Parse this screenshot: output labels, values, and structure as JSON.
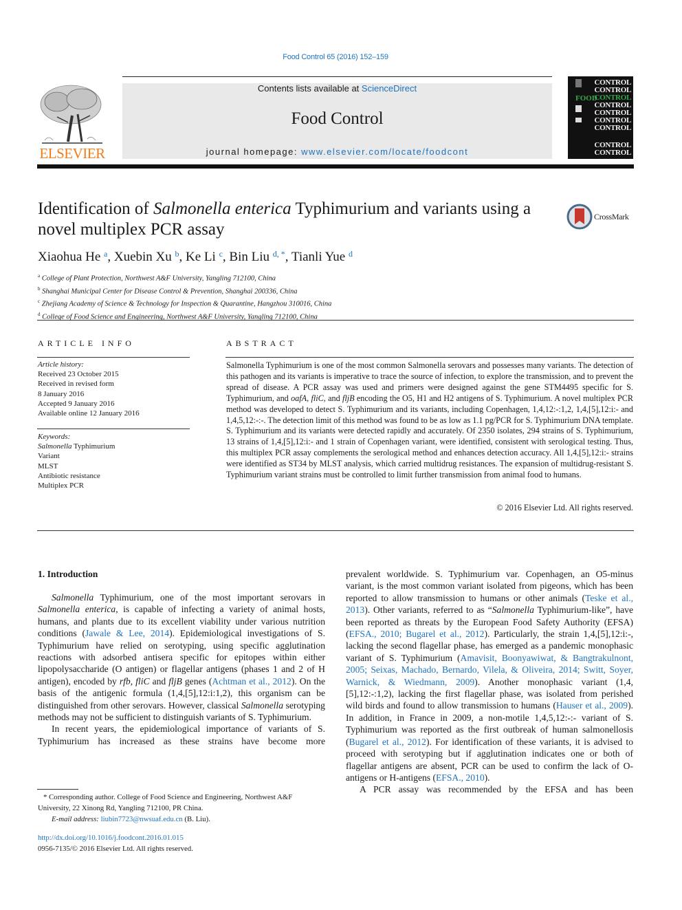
{
  "header": {
    "citation": "Food Control 65 (2016) 152–159",
    "publisher_name": "ELSEVIER",
    "contents_prefix": "Contents lists available at ",
    "contents_link": "ScienceDirect",
    "journal_title": "Food Control",
    "homepage_prefix": "journal homepage: ",
    "homepage_link": "www.elsevier.com/locate/foodcont",
    "cover": {
      "word": "CONTROL",
      "food_word": "FOOD",
      "colors": {
        "background": "#111111",
        "food": "#37a84a",
        "text": "#f2f2f2"
      }
    },
    "colors": {
      "link": "#1e73be",
      "publisher": "#f07c1c",
      "box": "#e9e9e9"
    }
  },
  "article": {
    "title_part1": "Identification of ",
    "title_italic": "Salmonella enterica",
    "title_part2": " Typhimurium and variants using a novel multiplex PCR assay",
    "crossmark_label": "CrossMark",
    "authors": [
      {
        "name": "Xiaohua He",
        "sup": "a"
      },
      {
        "name": "Xuebin Xu",
        "sup": "b"
      },
      {
        "name": "Ke Li",
        "sup": "c"
      },
      {
        "name": "Bin Liu",
        "sup": "d, *"
      },
      {
        "name": "Tianli Yue",
        "sup": "d"
      }
    ],
    "affiliations": [
      {
        "key": "a",
        "text": "College of Plant Protection, Northwest A&F University, Yangling 712100, China"
      },
      {
        "key": "b",
        "text": "Shanghai Municipal Center for Disease Control & Prevention, Shanghai 200336, China"
      },
      {
        "key": "c",
        "text": "Zhejiang Academy of Science & Technology for Inspection & Quarantine, Hangzhou 310016, China"
      },
      {
        "key": "d",
        "text": "College of Food Science and Engineering, Northwest A&F University, Yangling 712100, China"
      }
    ]
  },
  "article_info": {
    "heading": "ARTICLE INFO",
    "history_label": "Article history:",
    "history": [
      "Received 23 October 2015",
      "Received in revised form",
      "8 January 2016",
      "Accepted 9 January 2016",
      "Available online 12 January 2016"
    ],
    "keywords_label": "Keywords:",
    "keyword1_italic": "Salmonella",
    "keyword1_rest": " Typhimurium",
    "keywords": [
      "Variant",
      "MLST",
      "Antibiotic resistance",
      "Multiplex PCR"
    ]
  },
  "abstract": {
    "heading": "ABSTRACT",
    "s1": "Salmonella Typhimurium is one of the most common Salmonella serovars and possesses many variants. The detection of this pathogen and its variants is imperative to trace the source of infection, to explore the transmission, and to prevent the spread of disease. A PCR assay was used and primers were designed against the gene STM4495 specific for S. Typhimurium, and ",
    "g1": "oafA",
    "c1": ", ",
    "g2": "fliC",
    "c2": ", and ",
    "g3": "fljB",
    "s2": " encoding the O5, H1 and H2 antigens of S. Typhimurium. A novel multiplex PCR method was developed to detect S. Typhimurium and its variants, including Copenhagen, 1,4,12:-:1,2, 1,4,[5],12:i:- and 1,4,5,12:-:-. The detection limit of this method was found to be as low as 1.1 pg/PCR for S. Typhimurium DNA template. S. Typhimurium and its variants were detected rapidly and accurately. Of 2350 isolates, 294 strains of S. Typhimurium, 13 strains of 1,4,[5],12:i:- and 1 strain of Copenhagen variant, were identified, consistent with serological testing. Thus, this multiplex PCR assay complements the serological method and enhances detection accuracy. All 1,4,[5],12:i:- strains were identified as ST34 by MLST analysis, which carried multidrug resistances. The expansion of multidrug-resistant S. Typhimurium variant strains must be controlled to limit further transmission from animal food to humans.",
    "copyright": "© 2016 Elsevier Ltd. All rights reserved."
  },
  "body": {
    "section_heading": "1.  Introduction",
    "left": {
      "p1": [
        {
          "t": "Salmonella",
          "i": true
        },
        {
          "t": " Typhimurium, one of the most important serovars in "
        },
        {
          "t": "Salmonella enterica",
          "i": true
        },
        {
          "t": ", is capable of infecting a variety of animal hosts, humans, and plants due to its excellent viability under various nutrition conditions ("
        },
        {
          "t": "Jawale & Lee, 2014",
          "l": true
        },
        {
          "t": "). Epidemiological investigations of S. Typhimurium have relied on serotyping, using specific agglutination reactions with adsorbed antisera specific for epitopes within either lipopolysaccharide (O antigen) or flagellar antigens (phases 1 and 2 of H antigen), encoded by "
        },
        {
          "t": "rfb",
          "i": true
        },
        {
          "t": ", "
        },
        {
          "t": "fliC",
          "i": true
        },
        {
          "t": " and "
        },
        {
          "t": "fljB",
          "i": true
        },
        {
          "t": " genes ("
        },
        {
          "t": "Achtman et al., 2012",
          "l": true
        },
        {
          "t": "). On the basis of the antigenic formula (1,4,[5],12:i:1,2), this organism can be distinguished from other serovars. However, classical "
        },
        {
          "t": "Salmonella",
          "i": true
        },
        {
          "t": " serotyping methods may not be sufficient to distinguish variants of S. Typhimurium."
        }
      ],
      "p2": [
        {
          "t": "In recent years, the epidemiological importance of variants of S. Typhimurium has increased as these strains have become more"
        }
      ]
    },
    "right": {
      "p1": [
        {
          "t": "prevalent worldwide. S. Typhimurium var. Copenhagen, an O5-minus variant, is the most common variant isolated from pigeons, which has been reported to allow transmission to humans or other animals ("
        },
        {
          "t": "Teske et al., 2013",
          "l": true
        },
        {
          "t": "). Other variants, referred to as “"
        },
        {
          "t": "Salmonella",
          "i": true
        },
        {
          "t": " Typhimurium-like”, have been reported as threats by the European Food Safety Authority (EFSA) ("
        },
        {
          "t": "EFSA., 2010; Bugarel et al., 2012",
          "l": true
        },
        {
          "t": "). Particularly, the strain 1,4,[5],12:i:-, lacking the second flagellar phase, has emerged as a pandemic monophasic variant of S. Typhimurium ("
        },
        {
          "t": "Amavisit, Boonyawiwat, & Bangtrakulnont, 2005; Seixas, Machado, Bernardo, Vilela, & Oliveira, 2014; Switt, Soyer, Warnick, & Wiedmann, 2009",
          "l": true
        },
        {
          "t": "). Another monophasic variant (1,4,[5],12:-:1,2), lacking the first flagellar phase, was isolated from perished wild birds and found to allow transmission to humans ("
        },
        {
          "t": "Hauser et al., 2009",
          "l": true
        },
        {
          "t": "). In addition, in France in 2009, a non-motile 1,4,5,12:-:- variant of S. Typhimurium was reported as the first outbreak of human salmonellosis ("
        },
        {
          "t": "Bugarel et al., 2012",
          "l": true
        },
        {
          "t": "). For identification of these variants, it is advised to proceed with serotyping but if agglutination indicates one or both of flagellar antigens are absent, PCR can be used to confirm the lack of O-antigens or H-antigens ("
        },
        {
          "t": "EFSA., 2010",
          "l": true
        },
        {
          "t": ")."
        }
      ],
      "p2": [
        {
          "t": "A PCR assay was recommended by the EFSA and has been"
        }
      ]
    }
  },
  "footnote": {
    "corresponding": "* Corresponding author. College of Food Science and Engineering, Northwest A&F University, 22 Xinong Rd, Yangling 712100, PR China.",
    "email_label": "E-mail address: ",
    "email": "liubin7723@nwsuaf.edu.cn",
    "email_suffix": " (B. Liu).",
    "doi": "http://dx.doi.org/10.1016/j.foodcont.2016.01.015",
    "issn_copyright": "0956-7135/© 2016 Elsevier Ltd. All rights reserved."
  }
}
